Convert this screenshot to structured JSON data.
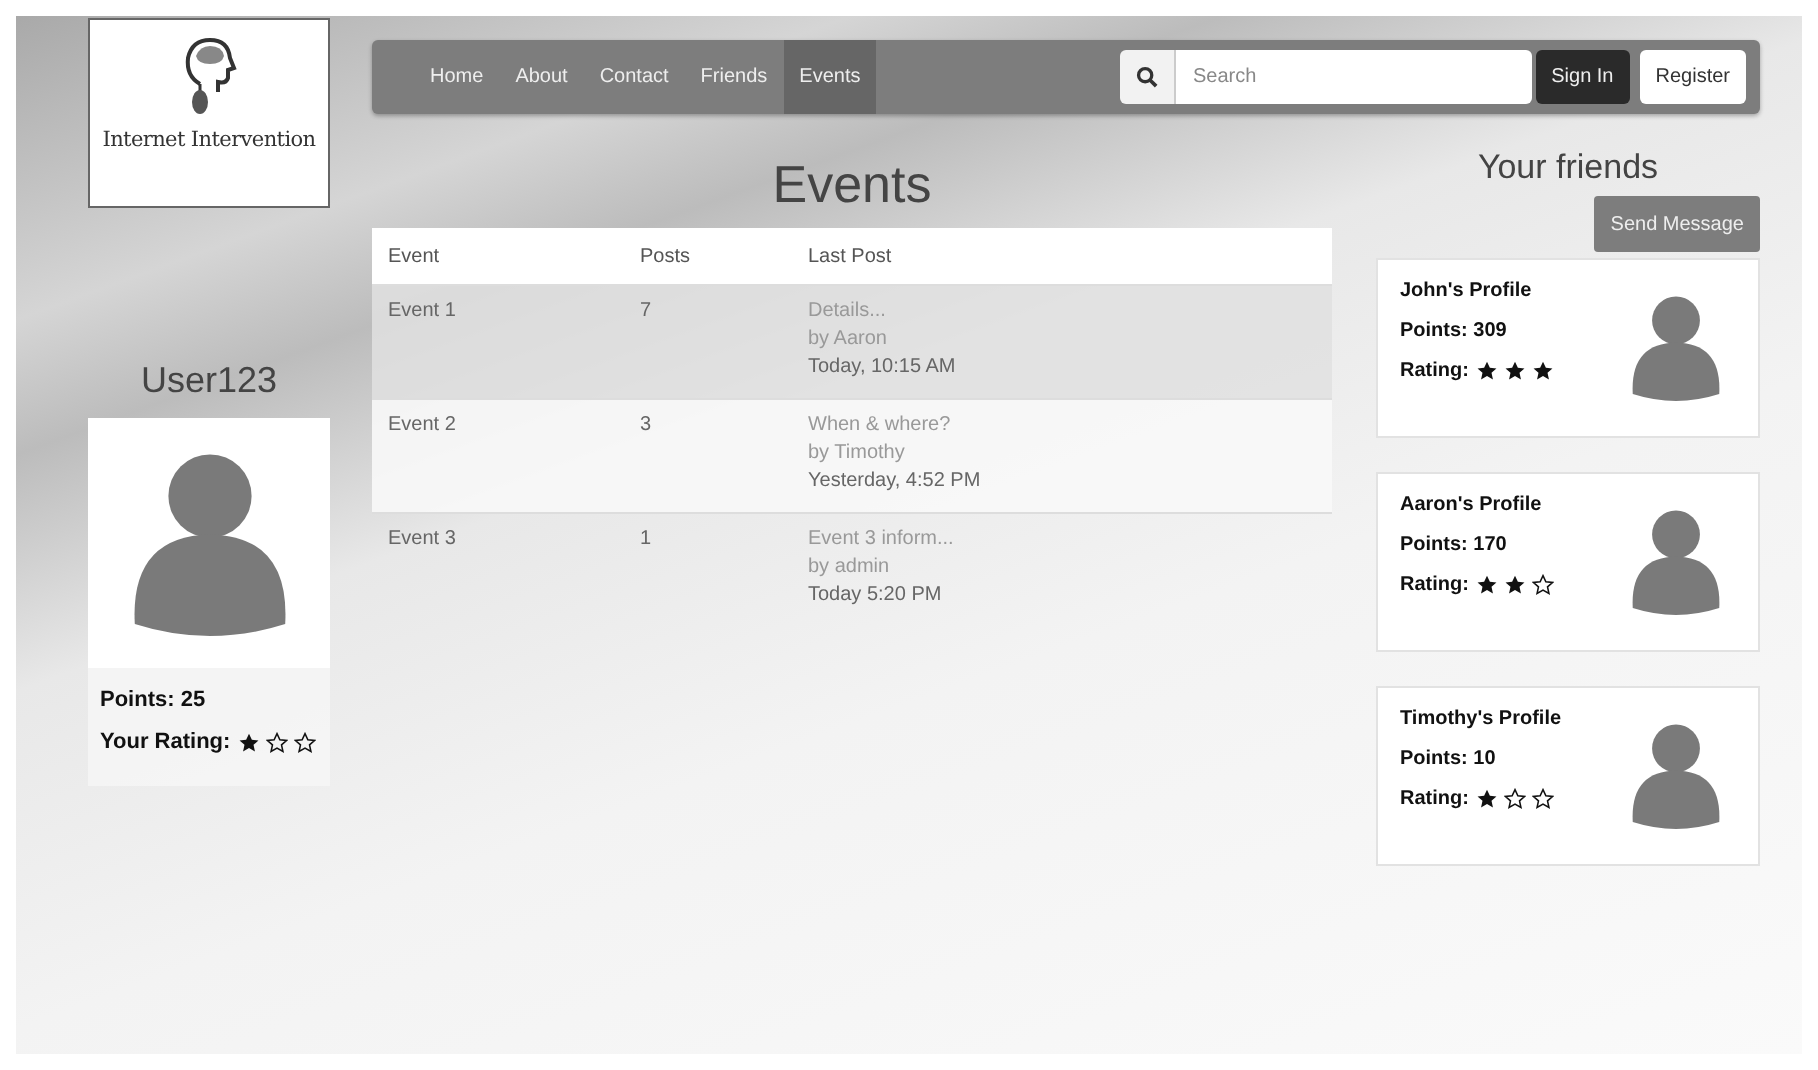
{
  "logo": {
    "text": "Internet Intervention"
  },
  "nav": {
    "items": [
      {
        "label": "Home",
        "selected": false
      },
      {
        "label": "About",
        "selected": false
      },
      {
        "label": "Contact",
        "selected": false
      },
      {
        "label": "Friends",
        "selected": false
      },
      {
        "label": "Events",
        "selected": true
      }
    ],
    "search": {
      "placeholder": "Search"
    },
    "buttons": [
      {
        "label": "Sign In",
        "kind": "dark"
      },
      {
        "label": "Register",
        "kind": "light"
      }
    ]
  },
  "user": {
    "name": "User123",
    "points": "Points: 25",
    "rating_label": "Your Rating:",
    "stars": 1
  },
  "events": {
    "title": "Events",
    "columns": [
      "Event",
      "Posts",
      "Last Post"
    ],
    "rows": [
      {
        "event": "Event 1",
        "posts": "7",
        "last_post": {
          "title": "Details...",
          "by": "by Aaron",
          "time": "Today, 10:15 AM"
        }
      },
      {
        "event": "Event 2",
        "posts": "3",
        "last_post": {
          "title": "When & where?",
          "by": "by Timothy",
          "time": "Yesterday, 4:52 PM"
        }
      },
      {
        "event": "Event 3",
        "posts": "1",
        "last_post": {
          "title": "Event 3 inform...",
          "by": "by admin",
          "time": "Today 5:20 PM"
        }
      }
    ]
  },
  "friends": {
    "title": "Your friends",
    "button": "Send Message",
    "cards": [
      {
        "name": "John's Profile",
        "points": "Points: 309",
        "rating_label": "Rating:",
        "stars": 3
      },
      {
        "name": "Aaron's Profile",
        "points": "Points: 170",
        "rating_label": "Rating:",
        "stars": 2
      },
      {
        "name": "Timothy's Profile",
        "points": "Points: 10",
        "rating_label": "Rating:",
        "stars": 1
      }
    ]
  }
}
